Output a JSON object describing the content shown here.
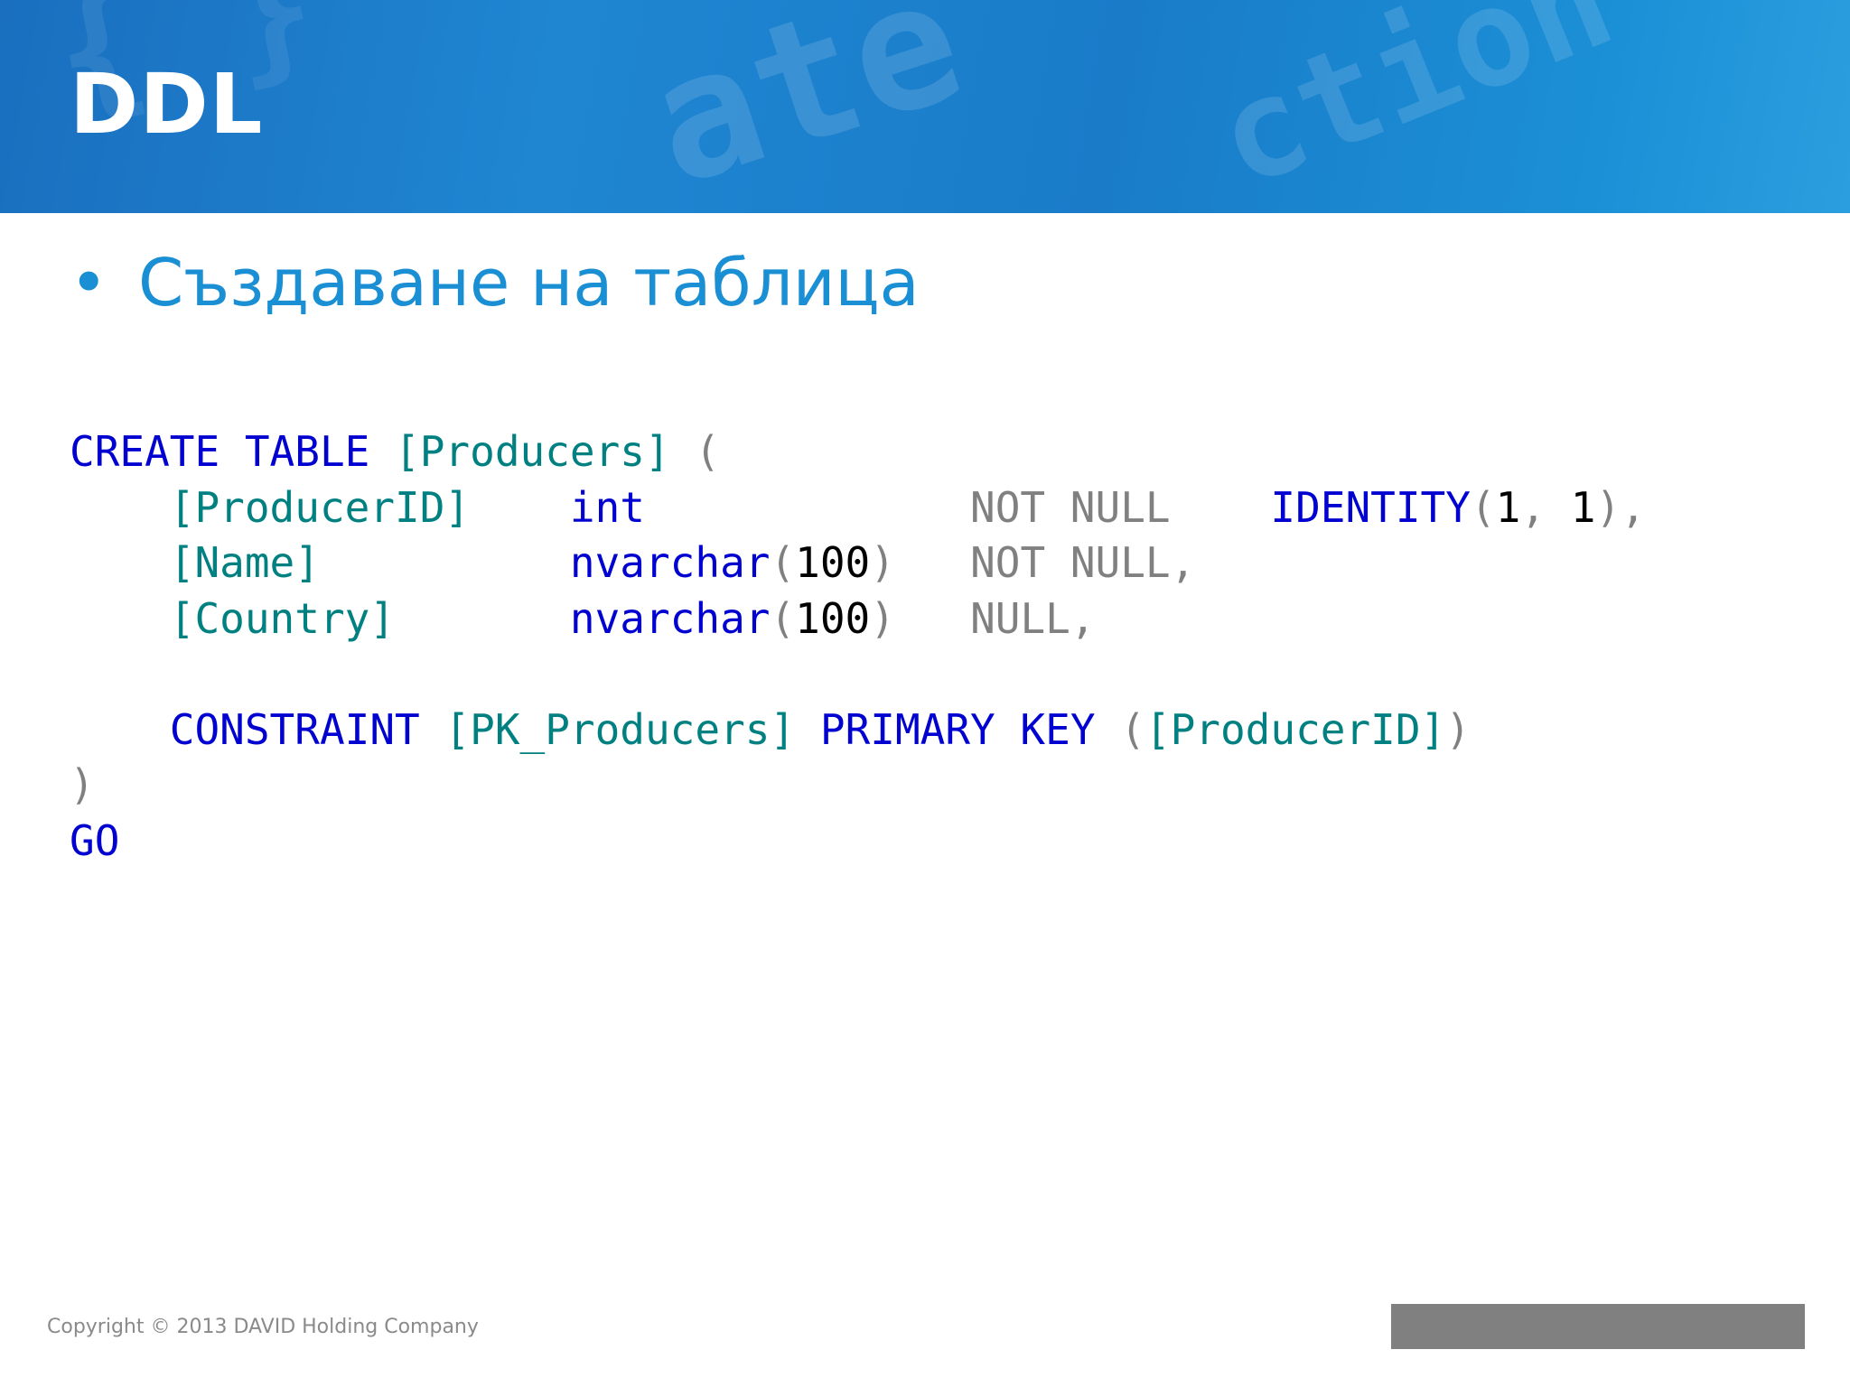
{
  "slide": {
    "title": "DDL",
    "bullet_symbol": "•",
    "bullet_text": "Създаване на таблица",
    "footer": "Copyright © 2013 DAVID Holding Company"
  },
  "colors": {
    "header_blue": "#1f86d2",
    "bullet_blue": "#1a8fd4",
    "keyword": "#0000d0",
    "identifier": "#008080",
    "punctuation": "#808080",
    "footer_bar": "#808080"
  },
  "code": {
    "lines": [
      [
        {
          "t": "CREATE TABLE",
          "c": "kw"
        },
        {
          "t": " ",
          "c": ""
        },
        {
          "t": "[Producers]",
          "c": "id"
        },
        {
          "t": " (",
          "c": "gr"
        }
      ],
      [
        {
          "t": "    ",
          "c": ""
        },
        {
          "t": "[ProducerID]",
          "c": "id"
        },
        {
          "t": "    ",
          "c": ""
        },
        {
          "t": "int",
          "c": "kw"
        },
        {
          "t": "             ",
          "c": ""
        },
        {
          "t": "NOT NULL",
          "c": "gr"
        },
        {
          "t": "    ",
          "c": ""
        },
        {
          "t": "IDENTITY",
          "c": "kw"
        },
        {
          "t": "(",
          "c": "gr"
        },
        {
          "t": "1",
          "c": "num"
        },
        {
          "t": ", ",
          "c": "gr"
        },
        {
          "t": "1",
          "c": "num"
        },
        {
          "t": "),",
          "c": "gr"
        }
      ],
      [
        {
          "t": "    ",
          "c": ""
        },
        {
          "t": "[Name]",
          "c": "id"
        },
        {
          "t": "          ",
          "c": ""
        },
        {
          "t": "nvarchar",
          "c": "kw"
        },
        {
          "t": "(",
          "c": "gr"
        },
        {
          "t": "100",
          "c": "num"
        },
        {
          "t": ")",
          "c": "gr"
        },
        {
          "t": "   ",
          "c": ""
        },
        {
          "t": "NOT NULL,",
          "c": "gr"
        }
      ],
      [
        {
          "t": "    ",
          "c": ""
        },
        {
          "t": "[Country]",
          "c": "id"
        },
        {
          "t": "       ",
          "c": ""
        },
        {
          "t": "nvarchar",
          "c": "kw"
        },
        {
          "t": "(",
          "c": "gr"
        },
        {
          "t": "100",
          "c": "num"
        },
        {
          "t": ")",
          "c": "gr"
        },
        {
          "t": "   ",
          "c": ""
        },
        {
          "t": "NULL,",
          "c": "gr"
        }
      ],
      [],
      [
        {
          "t": "    ",
          "c": ""
        },
        {
          "t": "CONSTRAINT",
          "c": "kw"
        },
        {
          "t": " ",
          "c": ""
        },
        {
          "t": "[PK_Producers]",
          "c": "id"
        },
        {
          "t": " ",
          "c": ""
        },
        {
          "t": "PRIMARY KEY",
          "c": "kw"
        },
        {
          "t": " (",
          "c": "gr"
        },
        {
          "t": "[ProducerID]",
          "c": "id"
        },
        {
          "t": ")",
          "c": "gr"
        }
      ],
      [
        {
          "t": ")",
          "c": "gr"
        }
      ],
      [
        {
          "t": "GO",
          "c": "kw"
        }
      ]
    ]
  }
}
